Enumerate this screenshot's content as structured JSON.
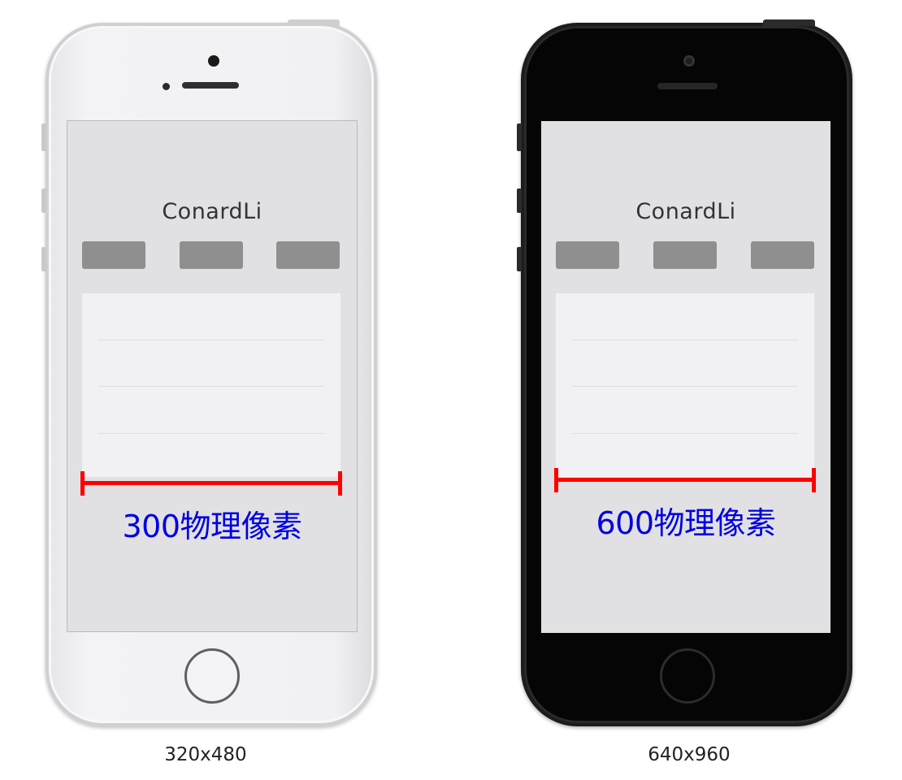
{
  "phones": [
    {
      "variant": "white",
      "app_title": "ConardLi",
      "measure_label": "300物理像素",
      "caption": "320x480"
    },
    {
      "variant": "black",
      "app_title": "ConardLi",
      "measure_label": "600物理像素",
      "caption": "640x960"
    }
  ],
  "colors": {
    "measure_line": "#ff0000",
    "measure_text": "#0000e0",
    "screen_bg": "#e1e1e4",
    "tab_fill": "#8f8f90",
    "card_bg": "#f1f1f3"
  }
}
